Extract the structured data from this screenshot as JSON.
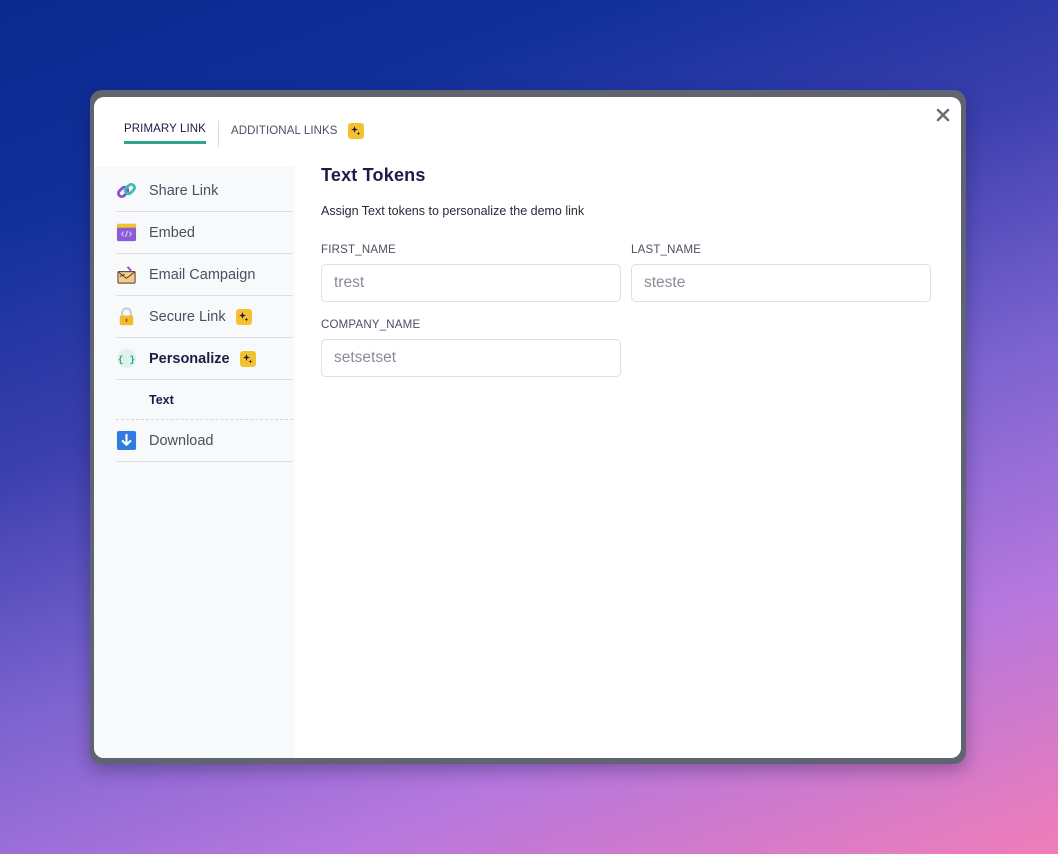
{
  "tabs": [
    {
      "label": "PRIMARY LINK",
      "active": true
    },
    {
      "label": "ADDITIONAL LINKS",
      "active": false,
      "badge": "sparkle-icon"
    }
  ],
  "close_icon": "close-icon",
  "sidebar": {
    "items": [
      {
        "label": "Share Link",
        "icon": "link-icon"
      },
      {
        "label": "Embed",
        "icon": "embed-icon"
      },
      {
        "label": "Email Campaign",
        "icon": "email-icon"
      },
      {
        "label": "Secure Link",
        "icon": "lock-icon",
        "badge": "sparkle-icon"
      },
      {
        "label": "Personalize",
        "icon": "braces-icon",
        "badge": "sparkle-icon",
        "active": true
      },
      {
        "label": "Download",
        "icon": "download-icon"
      }
    ],
    "subitems": [
      {
        "label": "Text",
        "parent": "Personalize",
        "active": true
      }
    ]
  },
  "main": {
    "title": "Text Tokens",
    "description": "Assign Text tokens to personalize the demo link",
    "fields": [
      {
        "label": "FIRST_NAME",
        "value": "trest"
      },
      {
        "label": "LAST_NAME",
        "value": "steste"
      },
      {
        "label": "COMPANY_NAME",
        "value": "setsetset"
      }
    ]
  },
  "colors": {
    "accent": "#2fa58c",
    "badge": "#f2c230",
    "heading": "#1d1b48"
  }
}
